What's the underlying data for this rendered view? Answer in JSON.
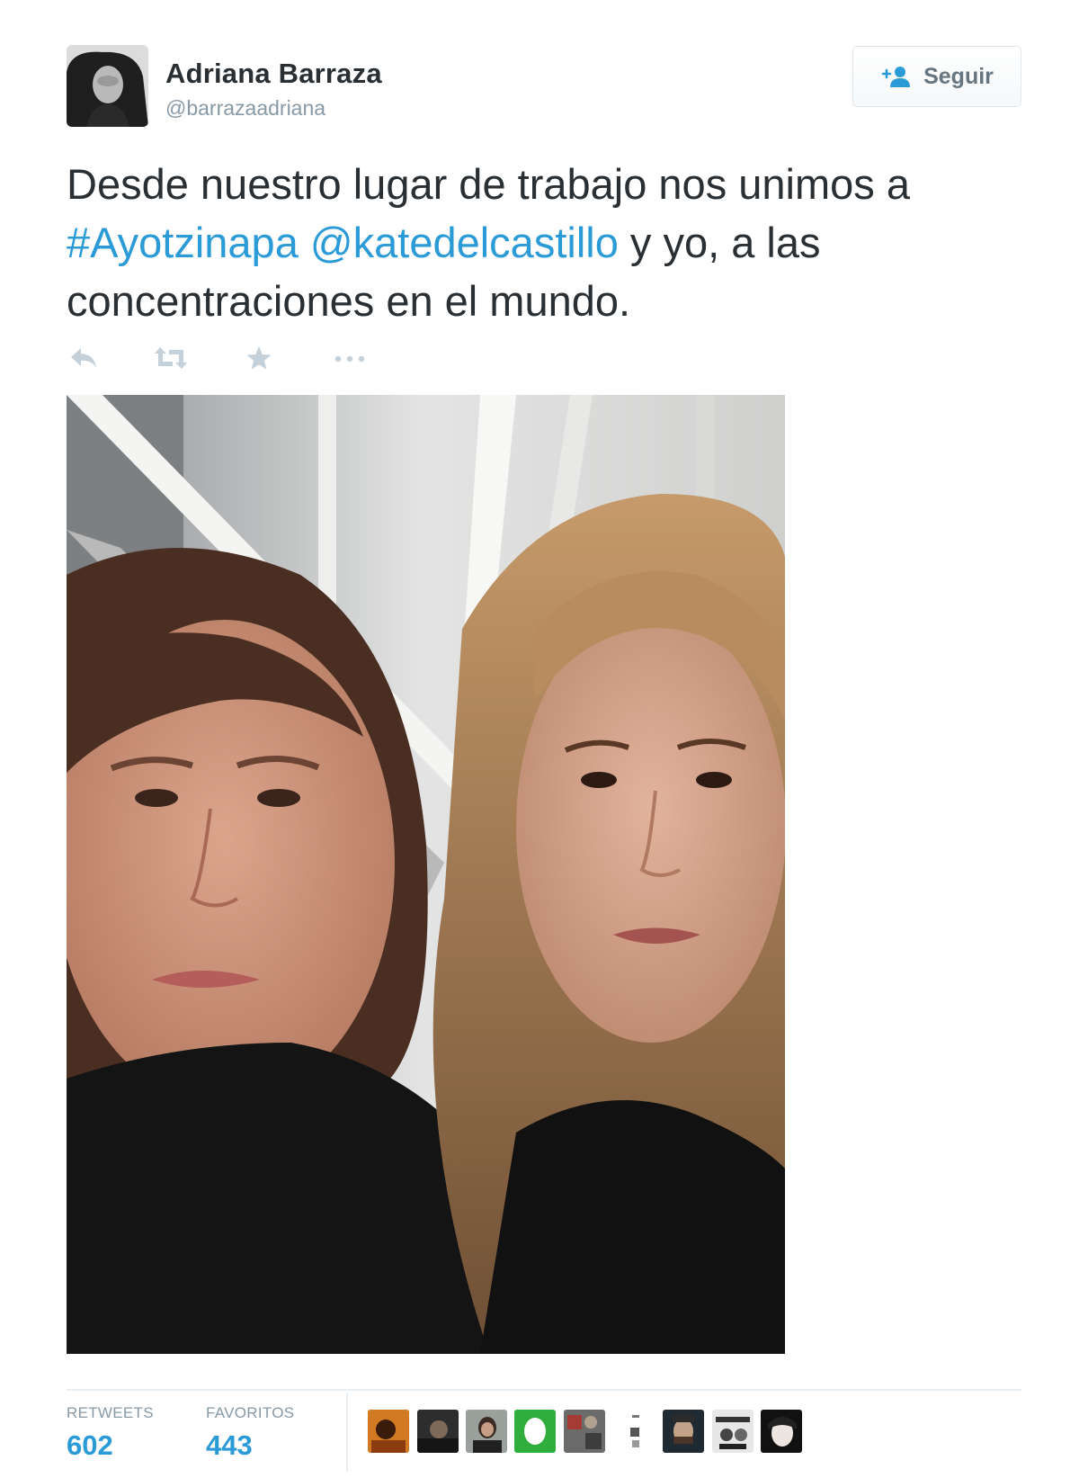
{
  "user": {
    "name": "Adriana Barraza",
    "handle": "@barrazaadriana"
  },
  "follow_button": {
    "label": "Seguir",
    "icon": "follow-person-plus-icon"
  },
  "tweet": {
    "text_before": "Desde nuestro lugar de trabajo nos unimos a ",
    "hashtag": "#Ayotzinapa",
    "space": " ",
    "mention": "@katedelcastillo",
    "text_after": " y yo, a las concentraciones en el mundo."
  },
  "actions": [
    "reply-icon",
    "retweet-icon",
    "favorite-star-icon",
    "more-dots-icon"
  ],
  "stats": {
    "retweets_label": "RETWEETS",
    "retweets_count": "602",
    "favorites_label": "FAVORITOS",
    "favorites_count": "443"
  },
  "colors": {
    "link": "#2b9bd8",
    "text": "#292f33",
    "muted": "#8899a6",
    "border": "#e1e8ed"
  }
}
